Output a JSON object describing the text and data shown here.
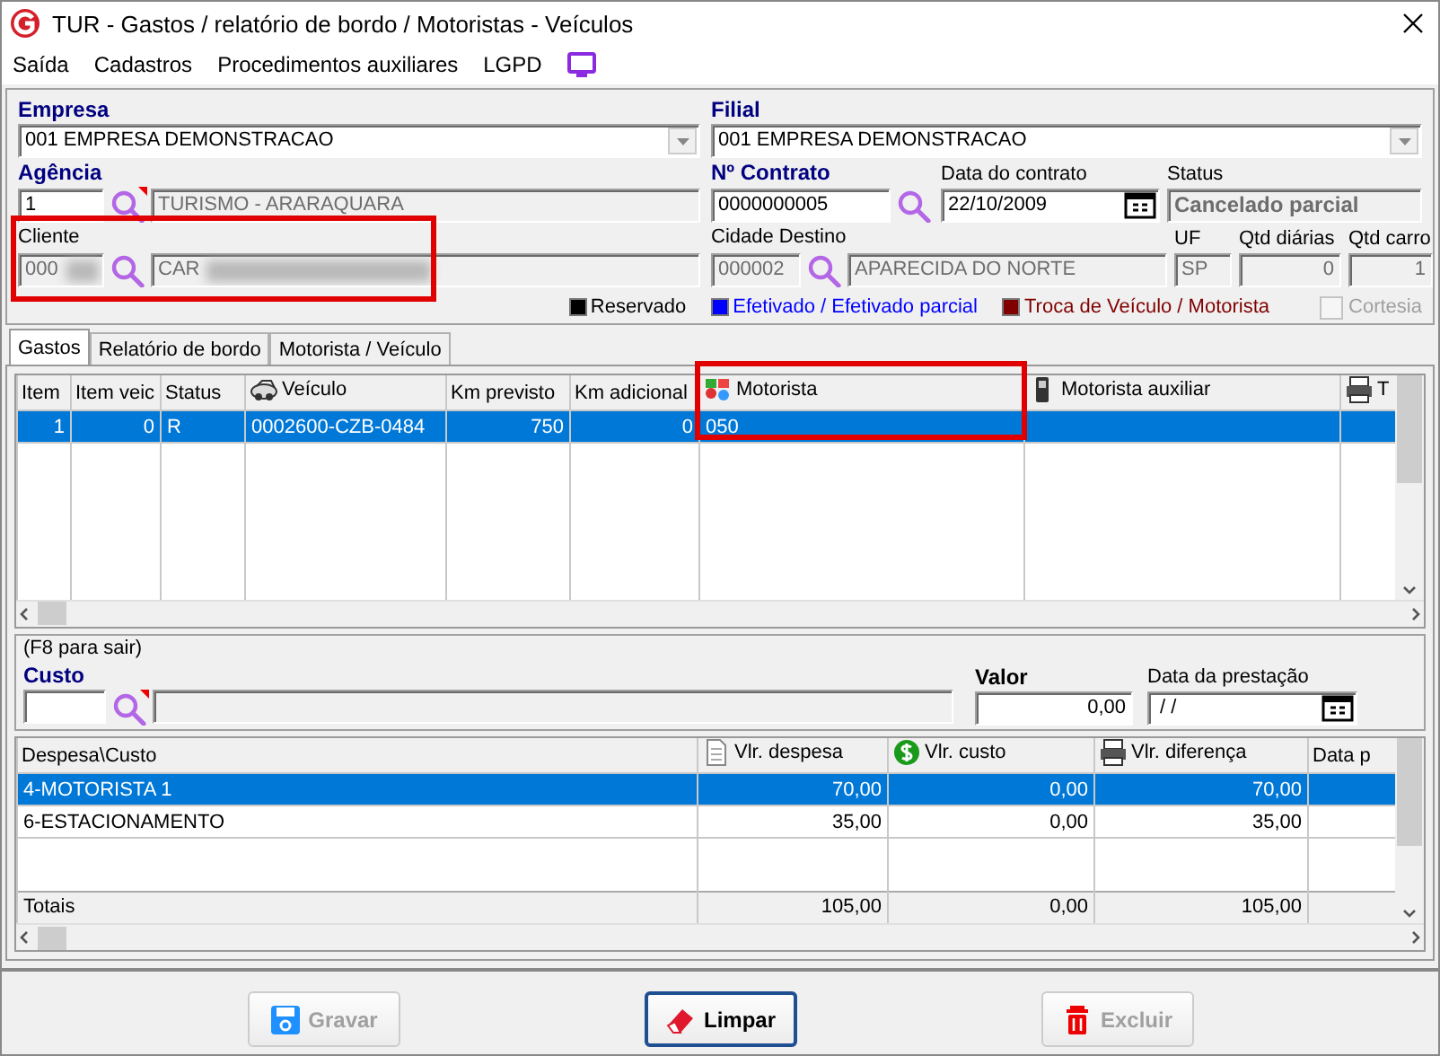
{
  "window": {
    "title": "TUR - Gastos / relatório de bordo / Motoristas - Veículos"
  },
  "menu": [
    {
      "label": "Saída"
    },
    {
      "label": "Cadastros"
    },
    {
      "label": "Procedimentos auxiliares"
    },
    {
      "label": "LGPD"
    }
  ],
  "empresa": {
    "label": "Empresa",
    "value": "001 EMPRESA DEMONSTRACAO"
  },
  "filial": {
    "label": "Filial",
    "value": "001 EMPRESA DEMONSTRACAO"
  },
  "agencia": {
    "label": "Agência",
    "code": "1",
    "name": "TURISMO - ARARAQUARA"
  },
  "cliente": {
    "label": "Cliente",
    "code": "000",
    "name": "CAR"
  },
  "contrato": {
    "label": "Nº Contrato",
    "value": "0000000005"
  },
  "data_contrato": {
    "label": "Data do contrato",
    "value": "22/10/2009"
  },
  "status": {
    "label": "Status",
    "value": "Cancelado parcial"
  },
  "cidade_destino": {
    "label": "Cidade Destino",
    "code": "000002",
    "name": "APARECIDA DO NORTE"
  },
  "uf": {
    "label": "UF",
    "value": "SP"
  },
  "qtd_diarias": {
    "label": "Qtd diárias",
    "value": "0"
  },
  "qtd_carro": {
    "label": "Qtd carro",
    "value": "1"
  },
  "legend": [
    {
      "label": "Reservado",
      "color": "#000000"
    },
    {
      "label": "Efetivado / Efetivado parcial",
      "color": "#0000ff"
    },
    {
      "label": "Troca de Veículo / Motorista",
      "color": "#800000"
    }
  ],
  "cortesia": {
    "label": "Cortesia",
    "checked": false,
    "disabled": true
  },
  "tabs": [
    {
      "label": "Gastos",
      "selected": true
    },
    {
      "label": "Relatório de bordo",
      "selected": false
    },
    {
      "label": "Motorista / Veículo",
      "selected": false
    }
  ],
  "vehicles_table": {
    "columns": [
      {
        "label": "Item",
        "kind": "plain"
      },
      {
        "label": "Item veic",
        "kind": "plain"
      },
      {
        "label": "Status",
        "kind": "plain"
      },
      {
        "label": "Veículo",
        "kind": "car"
      },
      {
        "label": "Km previsto",
        "kind": "plain"
      },
      {
        "label": "Km adicional",
        "kind": "plain"
      },
      {
        "label": "Motorista",
        "kind": "people"
      },
      {
        "label": "Motorista auxiliar",
        "kind": "phone"
      },
      {
        "label": "T",
        "kind": "printer"
      }
    ],
    "rows": [
      {
        "cells": [
          "1",
          "0",
          "R",
          "0002600-CZB-0484",
          "750",
          "0",
          "050"
        ],
        "selected": true
      }
    ]
  },
  "expense_entry": {
    "hint": "(F8 para sair)",
    "custo_label": "Custo",
    "valor_label": "Valor",
    "valor": "0,00",
    "data_label": "Data da prestação",
    "data": " / /"
  },
  "expenses_table": {
    "columns": [
      {
        "label": "Despesa\\Custo",
        "kind": "plain"
      },
      {
        "label": "Vlr. despesa",
        "kind": "document"
      },
      {
        "label": "Vlr. custo",
        "kind": "money"
      },
      {
        "label": "Vlr. diferença",
        "kind": "printer"
      },
      {
        "label": "Data p",
        "kind": "plain"
      }
    ],
    "rows": [
      {
        "cells": [
          "4-MOTORISTA 1",
          "70,00",
          "0,00",
          "70,00"
        ],
        "selected": true
      },
      {
        "cells": [
          "6-ESTACIONAMENTO",
          "35,00",
          "0,00",
          "35,00"
        ],
        "selected": false
      }
    ],
    "totals": [
      "Totais",
      "105,00",
      "0,00",
      "105,00"
    ]
  },
  "buttons": [
    {
      "label": "Gravar",
      "kind": "save",
      "disabled": true,
      "focused": false
    },
    {
      "label": "Limpar",
      "kind": "clear",
      "disabled": false,
      "focused": true
    },
    {
      "label": "Excluir",
      "kind": "delete",
      "disabled": true,
      "focused": false
    }
  ]
}
